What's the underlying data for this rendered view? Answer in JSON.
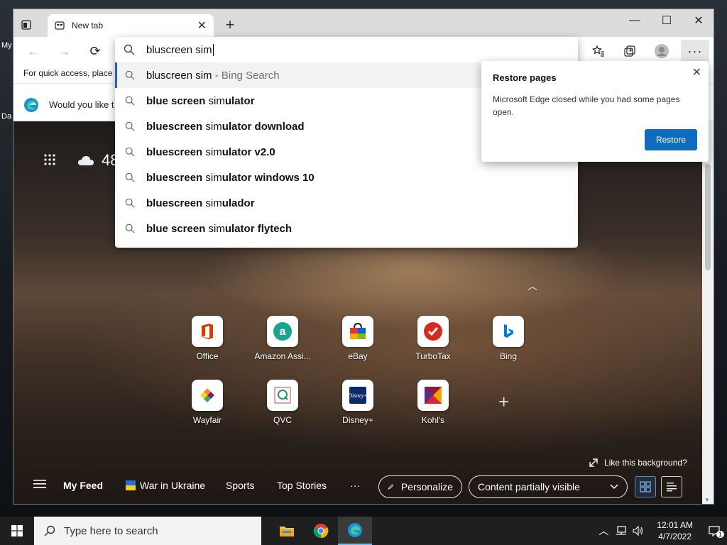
{
  "desktop": {
    "icon_label_1": "My",
    "icon_label_2": "Da"
  },
  "tab": {
    "title": "New tab"
  },
  "toolbar": {
    "favorites_hint": "For quick access, place y"
  },
  "address_bar": {
    "value": "bluscreen sim"
  },
  "suggestions": [
    {
      "prefix": "bluscreen sim",
      "bold": "",
      "suffix": " - Bing Search",
      "active": true
    },
    {
      "prefix": "",
      "bold": "blue screen ",
      "rest_plain": "sim",
      "rest_bold": "ulator"
    },
    {
      "prefix": "",
      "bold": "bluescreen ",
      "rest_plain": "sim",
      "rest_bold": "ulator download"
    },
    {
      "prefix": "",
      "bold": "bluescreen ",
      "rest_plain": "sim",
      "rest_bold": "ulator v2.0"
    },
    {
      "prefix": "",
      "bold": "bluescreen ",
      "rest_plain": "sim",
      "rest_bold": "ulator windows 10"
    },
    {
      "prefix": "",
      "bold": "bluescreen ",
      "rest_plain": "sim",
      "rest_bold": "ulador"
    },
    {
      "prefix": "",
      "bold": "blue screen ",
      "rest_plain": "sim",
      "rest_bold": "ulator flytech"
    }
  ],
  "infobar": {
    "text": "Would you like t"
  },
  "restore_popup": {
    "title": "Restore pages",
    "message": "Microsoft Edge closed while you had some pages open.",
    "button": "Restore"
  },
  "ntp": {
    "weather_temp": "48",
    "tiles": [
      {
        "label": "Office",
        "icon": "office-icon",
        "color": "#d83b01"
      },
      {
        "label": "Amazon Assi...",
        "icon": "amazon-assistant-icon",
        "color": "#1aa48c"
      },
      {
        "label": "eBay",
        "icon": "ebay-icon",
        "color": "#e53238"
      },
      {
        "label": "TurboTax",
        "icon": "turbotax-icon",
        "color": "#d52b1e"
      },
      {
        "label": "Bing",
        "icon": "bing-icon",
        "color": "#0078d4"
      },
      {
        "label": "Wayfair",
        "icon": "wayfair-icon",
        "color": "#7f187f"
      },
      {
        "label": "QVC",
        "icon": "qvc-icon",
        "color": "#2b8c7c"
      },
      {
        "label": "Disney+",
        "icon": "disney-plus-icon",
        "color": "#0d2a6b"
      },
      {
        "label": "Kohl's",
        "icon": "kohls-icon",
        "color": "#8b1c3c"
      }
    ],
    "like_background": "Like this background?",
    "feed": {
      "my_feed": "My Feed",
      "war_in_ukraine": "War in Ukraine",
      "sports": "Sports",
      "top_stories": "Top Stories",
      "more": "···",
      "personalize": "Personalize",
      "content_visibility": "Content partially visible"
    }
  },
  "taskbar": {
    "search_placeholder": "Type here to search",
    "time": "12:01 AM",
    "date": "4/7/2022",
    "notification_count": "1"
  },
  "colors": {
    "accent": "#0f6cbd",
    "taskbar": "#1f1f1f"
  }
}
